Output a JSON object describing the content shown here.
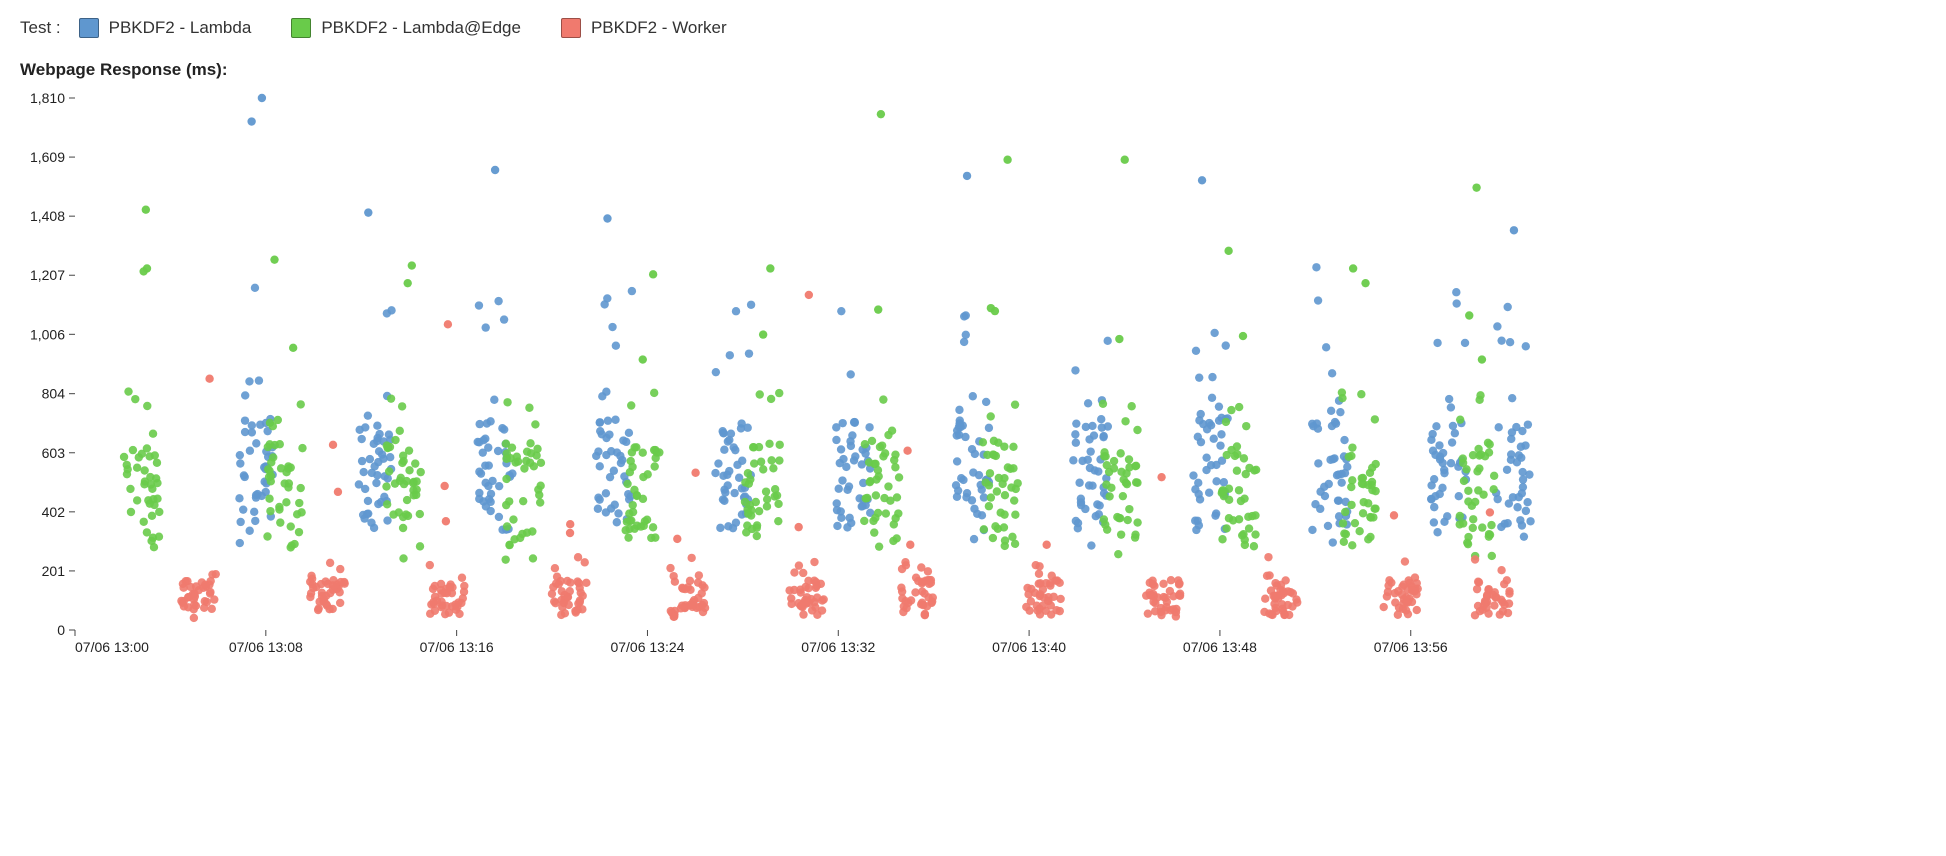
{
  "legend": {
    "prefix": "Test :",
    "items": [
      {
        "name": "PBKDF2 - Lambda",
        "color": "#5f97cf"
      },
      {
        "name": "PBKDF2 - Lambda@Edge",
        "color": "#69cb4a"
      },
      {
        "name": "PBKDF2 - Worker",
        "color": "#f07a6e"
      }
    ]
  },
  "subtitle": "Webpage Response (ms):",
  "chart_data": {
    "type": "scatter",
    "title": "",
    "xlabel": "",
    "ylabel": "",
    "ylim": [
      0,
      1810
    ],
    "y_ticks": [
      0,
      201,
      402,
      603,
      804,
      1006,
      1207,
      1408,
      1609,
      1810
    ],
    "x_tick_labels": [
      "07/06 13:00",
      "07/06 13:08",
      "07/06 13:16",
      "07/06 13:24",
      "07/06 13:32",
      "07/06 13:40",
      "07/06 13:48",
      "07/06 13:56"
    ],
    "x_tick_positions_min": [
      0,
      8,
      16,
      24,
      32,
      40,
      48,
      56
    ],
    "xlim_min": [
      0,
      61
    ],
    "series": [
      {
        "name": "PBKDF2 - Lambda",
        "color": "#5f97cf",
        "clusters": [
          {
            "x_center_min": 7.6,
            "n": 42,
            "y_range": [
              280,
              1180
            ],
            "dense_range": [
              340,
              720
            ],
            "outliers_y": [
              1810,
              1730
            ]
          },
          {
            "x_center_min": 12.6,
            "n": 44,
            "y_range": [
              280,
              1280
            ],
            "dense_range": [
              340,
              720
            ],
            "outliers_y": [
              1420
            ]
          },
          {
            "x_center_min": 17.6,
            "n": 44,
            "y_range": [
              280,
              1130
            ],
            "dense_range": [
              340,
              720
            ],
            "outliers_y": [
              1565
            ]
          },
          {
            "x_center_min": 22.6,
            "n": 44,
            "y_range": [
              280,
              1180
            ],
            "dense_range": [
              340,
              720
            ],
            "outliers_y": [
              1400
            ]
          },
          {
            "x_center_min": 27.6,
            "n": 44,
            "y_range": [
              280,
              1180
            ],
            "dense_range": [
              340,
              720
            ],
            "outliers_y": []
          },
          {
            "x_center_min": 32.6,
            "n": 44,
            "y_range": [
              280,
              1190
            ],
            "dense_range": [
              340,
              720
            ],
            "outliers_y": []
          },
          {
            "x_center_min": 37.6,
            "n": 44,
            "y_range": [
              280,
              1120
            ],
            "dense_range": [
              340,
              720
            ],
            "outliers_y": [
              1545
            ]
          },
          {
            "x_center_min": 42.6,
            "n": 44,
            "y_range": [
              280,
              1110
            ],
            "dense_range": [
              340,
              720
            ],
            "outliers_y": []
          },
          {
            "x_center_min": 47.6,
            "n": 44,
            "y_range": [
              280,
              1100
            ],
            "dense_range": [
              340,
              720
            ],
            "outliers_y": [
              1530
            ]
          },
          {
            "x_center_min": 52.6,
            "n": 44,
            "y_range": [
              280,
              1260
            ],
            "dense_range": [
              340,
              720
            ],
            "outliers_y": []
          },
          {
            "x_center_min": 57.6,
            "n": 44,
            "y_range": [
              280,
              1210
            ],
            "dense_range": [
              340,
              720
            ],
            "outliers_y": []
          },
          {
            "x_center_min": 60.3,
            "n": 40,
            "y_range": [
              300,
              1110
            ],
            "dense_range": [
              340,
              700
            ],
            "outliers_y": [
              1360
            ]
          }
        ]
      },
      {
        "name": "PBKDF2 - Lambda@Edge",
        "color": "#69cb4a",
        "clusters": [
          {
            "x_center_min": 2.8,
            "n": 40,
            "y_range": [
              260,
              820
            ],
            "dense_range": [
              300,
              640
            ],
            "outliers_y": [
              1430,
              1230,
              1220
            ]
          },
          {
            "x_center_min": 8.8,
            "n": 40,
            "y_range": [
              240,
              820
            ],
            "dense_range": [
              280,
              640
            ],
            "outliers_y": [
              1260,
              960
            ]
          },
          {
            "x_center_min": 13.8,
            "n": 40,
            "y_range": [
              230,
              820
            ],
            "dense_range": [
              280,
              640
            ],
            "outliers_y": [
              1240,
              1180
            ]
          },
          {
            "x_center_min": 18.8,
            "n": 40,
            "y_range": [
              230,
              860
            ],
            "dense_range": [
              280,
              640
            ],
            "outliers_y": []
          },
          {
            "x_center_min": 23.8,
            "n": 40,
            "y_range": [
              240,
              810
            ],
            "dense_range": [
              280,
              640
            ],
            "outliers_y": [
              1210,
              920
            ]
          },
          {
            "x_center_min": 28.8,
            "n": 40,
            "y_range": [
              240,
              810
            ],
            "dense_range": [
              280,
              640
            ],
            "outliers_y": [
              1230,
              1005
            ]
          },
          {
            "x_center_min": 33.8,
            "n": 40,
            "y_range": [
              240,
              810
            ],
            "dense_range": [
              280,
              640
            ],
            "outliers_y": [
              1755,
              1090
            ]
          },
          {
            "x_center_min": 38.8,
            "n": 40,
            "y_range": [
              240,
              810
            ],
            "dense_range": [
              280,
              640
            ],
            "outliers_y": [
              1600,
              1095,
              1085
            ]
          },
          {
            "x_center_min": 43.8,
            "n": 40,
            "y_range": [
              240,
              810
            ],
            "dense_range": [
              280,
              640
            ],
            "outliers_y": [
              1600,
              990
            ]
          },
          {
            "x_center_min": 48.8,
            "n": 40,
            "y_range": [
              240,
              810
            ],
            "dense_range": [
              280,
              640
            ],
            "outliers_y": [
              1290,
              1000
            ]
          },
          {
            "x_center_min": 53.8,
            "n": 40,
            "y_range": [
              240,
              810
            ],
            "dense_range": [
              280,
              640
            ],
            "outliers_y": [
              1230,
              1180
            ]
          },
          {
            "x_center_min": 58.8,
            "n": 40,
            "y_range": [
              240,
              810
            ],
            "dense_range": [
              280,
              640
            ],
            "outliers_y": [
              1505,
              1070,
              920
            ]
          }
        ]
      },
      {
        "name": "PBKDF2 - Worker",
        "color": "#f07a6e",
        "clusters": [
          {
            "x_center_min": 5.2,
            "n": 38,
            "y_range": [
              40,
              210
            ],
            "dense_range": [
              50,
              170
            ],
            "outliers_y": [
              855
            ]
          },
          {
            "x_center_min": 10.6,
            "n": 38,
            "y_range": [
              40,
              240
            ],
            "dense_range": [
              50,
              170
            ],
            "outliers_y": [
              630,
              470
            ]
          },
          {
            "x_center_min": 15.6,
            "n": 38,
            "y_range": [
              40,
              250
            ],
            "dense_range": [
              50,
              170
            ],
            "outliers_y": [
              1040,
              490,
              370
            ]
          },
          {
            "x_center_min": 20.7,
            "n": 38,
            "y_range": [
              40,
              260
            ],
            "dense_range": [
              50,
              170
            ],
            "outliers_y": [
              360,
              330
            ]
          },
          {
            "x_center_min": 25.7,
            "n": 38,
            "y_range": [
              40,
              250
            ],
            "dense_range": [
              50,
              170
            ],
            "outliers_y": [
              535,
              310
            ]
          },
          {
            "x_center_min": 30.7,
            "n": 38,
            "y_range": [
              40,
              250
            ],
            "dense_range": [
              50,
              170
            ],
            "outliers_y": [
              1140,
              350
            ]
          },
          {
            "x_center_min": 35.3,
            "n": 38,
            "y_range": [
              40,
              250
            ],
            "dense_range": [
              50,
              170
            ],
            "outliers_y": [
              610,
              290
            ]
          },
          {
            "x_center_min": 40.6,
            "n": 38,
            "y_range": [
              40,
              250
            ],
            "dense_range": [
              50,
              170
            ],
            "outliers_y": [
              290
            ]
          },
          {
            "x_center_min": 45.6,
            "n": 38,
            "y_range": [
              40,
              250
            ],
            "dense_range": [
              50,
              170
            ],
            "outliers_y": [
              520
            ]
          },
          {
            "x_center_min": 50.6,
            "n": 38,
            "y_range": [
              40,
              250
            ],
            "dense_range": [
              50,
              170
            ],
            "outliers_y": []
          },
          {
            "x_center_min": 55.6,
            "n": 38,
            "y_range": [
              40,
              250
            ],
            "dense_range": [
              50,
              170
            ],
            "outliers_y": [
              390
            ]
          },
          {
            "x_center_min": 59.4,
            "n": 36,
            "y_range": [
              40,
              240
            ],
            "dense_range": [
              50,
              170
            ],
            "outliers_y": [
              400
            ]
          }
        ]
      }
    ]
  }
}
